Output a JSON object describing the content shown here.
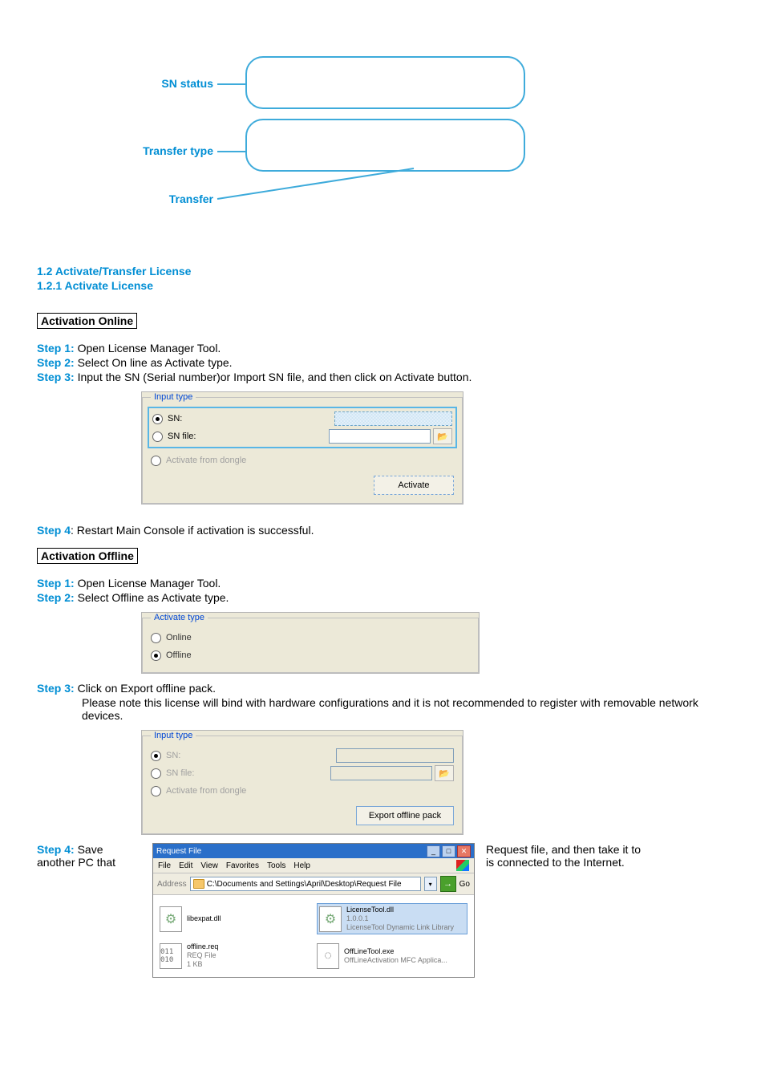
{
  "diagram": {
    "label1": "SN status",
    "label2": "Transfer type",
    "label3": "Transfer"
  },
  "section": {
    "h1": "1.2 Activate/Transfer License",
    "h2": "1.2.1 Activate License"
  },
  "online": {
    "title": "Activation Online",
    "step1": {
      "label": "Step 1:",
      "text": " Open License Manager Tool."
    },
    "step2": {
      "label": "Step 2:",
      "text": " Select On line as Activate type."
    },
    "step3": {
      "label": "Step 3:",
      "text": " Input the SN (Serial number)or Import SN file, and then click on Activate button."
    },
    "step4": {
      "label": "Step 4",
      "text": ": Restart Main Console if activation is successful."
    }
  },
  "input_dlg": {
    "legend": "Input type",
    "r_sn": "SN:",
    "r_snfile": "SN file:",
    "r_dongle": "Activate from dongle",
    "btn": "Activate",
    "browse_icon": "📂"
  },
  "offline": {
    "title": "Activation Offline",
    "step1": {
      "label": "Step 1:",
      "text": " Open License Manager Tool."
    },
    "step2": {
      "label": "Step 2:",
      "text": " Select Offline as Activate type."
    }
  },
  "activate_dlg": {
    "legend": "Activate type",
    "r_online": "Online",
    "r_offline": "Offline"
  },
  "step3_off": {
    "label": "Step 3:",
    "text": " Click on Export offline pack.",
    "note": "Please note this license will bind with hardware configurations and it is not recommended to register with removable network devices."
  },
  "input_dlg2": {
    "legend": "Input type",
    "r_sn": "SN:",
    "r_snfile": "SN file:",
    "r_dongle": "Activate from dongle",
    "btn": "Export offline pack",
    "browse_icon": "📂"
  },
  "step4_off": {
    "label": "Step 4:",
    "left1": " Save",
    "left2": "another PC that",
    "right1": "Request file, and then take it to",
    "right2": "is connected to the Internet."
  },
  "explorer": {
    "title": "Request File",
    "menu": {
      "file": "File",
      "edit": "Edit",
      "view": "View",
      "fav": "Favorites",
      "tools": "Tools",
      "help": "Help"
    },
    "addr_label": "Address",
    "addr_path": "C:\\Documents and Settings\\April\\Desktop\\Request File",
    "go": "Go",
    "files": {
      "f1": {
        "name": "libexpat.dll"
      },
      "f2": {
        "name": "LicenseTool.dll",
        "v": "1.0.0.1",
        "desc": "LicenseTool Dynamic Link Library"
      },
      "f3": {
        "name": "offline.req",
        "t": "REQ File",
        "s": "1 KB",
        "ico": "011\n010"
      },
      "f4": {
        "name": "OffLineTool.exe",
        "desc": "OffLineActivation MFC Applica..."
      }
    }
  }
}
